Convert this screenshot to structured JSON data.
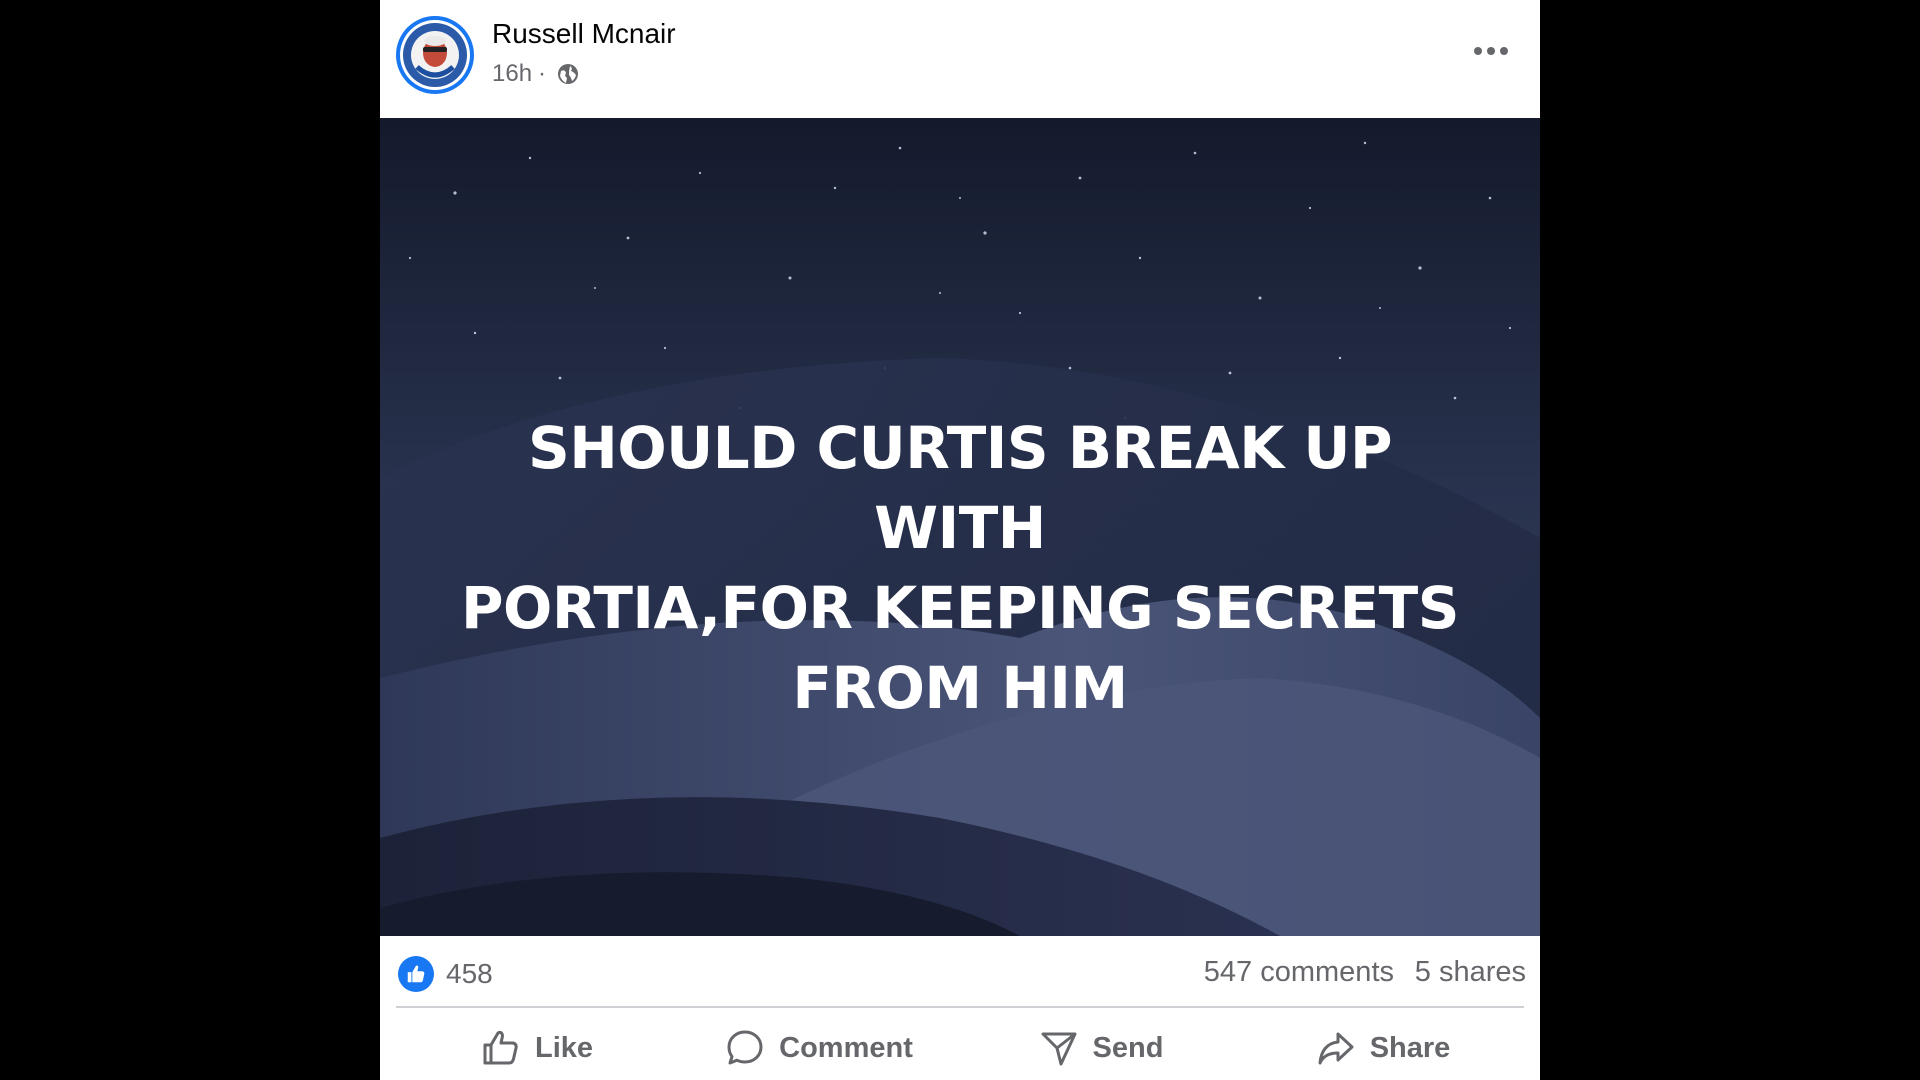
{
  "post": {
    "author_name": "Russell Mcnair",
    "timestamp": "16h",
    "separator": "·",
    "visibility_icon": "globe-icon",
    "more_icon": "more-options-icon",
    "image_text": "SHOULD CURTIS BREAK UP WITH PORTIA,FOR KEEPING SECRETS FROM HIM",
    "image_lines": [
      "SHOULD CURTIS BREAK UP WITH",
      "PORTIA,FOR KEEPING SECRETS",
      "FROM HIM"
    ]
  },
  "stats": {
    "reaction_icon": "like-reaction-icon",
    "reaction_count": "458",
    "comments": "547 comments",
    "shares": "5 shares"
  },
  "actions": {
    "like_label": "Like",
    "comment_label": "Comment",
    "send_label": "Send",
    "share_label": "Share"
  },
  "colors": {
    "page_background": "#000000",
    "card_background": "#ffffff",
    "accent": "#1877f2",
    "secondary_text": "#65676b",
    "primary_text": "#050505"
  }
}
